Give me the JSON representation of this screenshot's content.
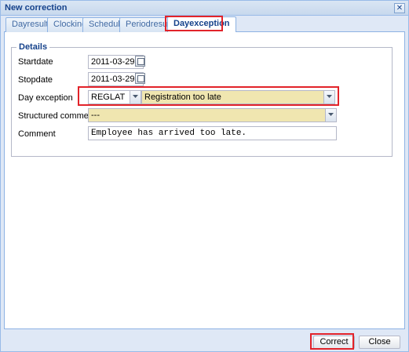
{
  "window": {
    "title": "New correction"
  },
  "tabs": [
    {
      "label": "Dayresult"
    },
    {
      "label": "Clocking"
    },
    {
      "label": "Schedule"
    },
    {
      "label": "Periodresult"
    },
    {
      "label": "Dayexception",
      "active": true
    }
  ],
  "details": {
    "legend": "Details",
    "startdate": {
      "label": "Startdate",
      "value": "2011-03-29"
    },
    "stopdate": {
      "label": "Stopdate",
      "value": "2011-03-29"
    },
    "day_exception": {
      "label": "Day exception",
      "code": "REGLAT",
      "description": "Registration too late"
    },
    "structured_comment": {
      "label": "Structured comment",
      "value": "---"
    },
    "comment": {
      "label": "Comment",
      "value": "Employee has arrived too late."
    }
  },
  "footer": {
    "correct_label": "Correct",
    "close_label": "Close"
  },
  "colors": {
    "highlight": "#e2232a",
    "accent": "#15428b",
    "field_yellow": "#f0e6b0"
  }
}
